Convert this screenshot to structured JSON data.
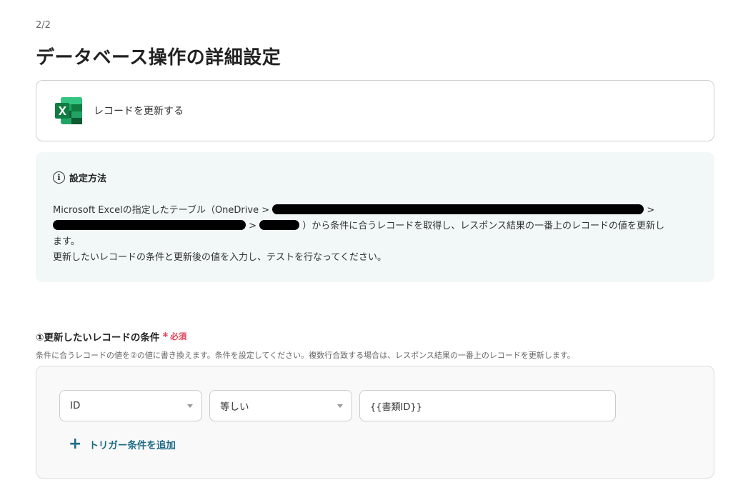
{
  "header": {
    "step": "2/2",
    "title": "データベース操作の詳細設定"
  },
  "action": {
    "icon": "excel-icon",
    "label": "レコードを更新する"
  },
  "info": {
    "icon": "info-circle-icon",
    "heading": "設定方法",
    "line1_a": "Microsoft Excelの指定したテーブル（OneDrive > ",
    "sep": " > ",
    "line2_b": " ）から条件に合うレコードを取得し、レスポンス結果の一番上のレコードの値を更新し",
    "line3": "ます。",
    "line4": "更新したいレコードの条件と更新後の値を入力し、テストを行なってください。"
  },
  "condition": {
    "title": "①更新したいレコードの条件",
    "required_mark": "*",
    "required_text": "必須",
    "description": "条件に合うレコードの値を②の値に書き換えます。条件を設定してください。複数行合致する場合は、レスポンス結果の一番上のレコードを更新します。",
    "field_select": "ID",
    "operator_select": "等しい",
    "value": "{{書類ID}}",
    "add_label": "トリガー条件を追加"
  },
  "colors": {
    "accent": "#1e6b86",
    "required": "#e0435a",
    "info_bg": "#f1f8f7",
    "excel_green": "#1d6f42"
  }
}
